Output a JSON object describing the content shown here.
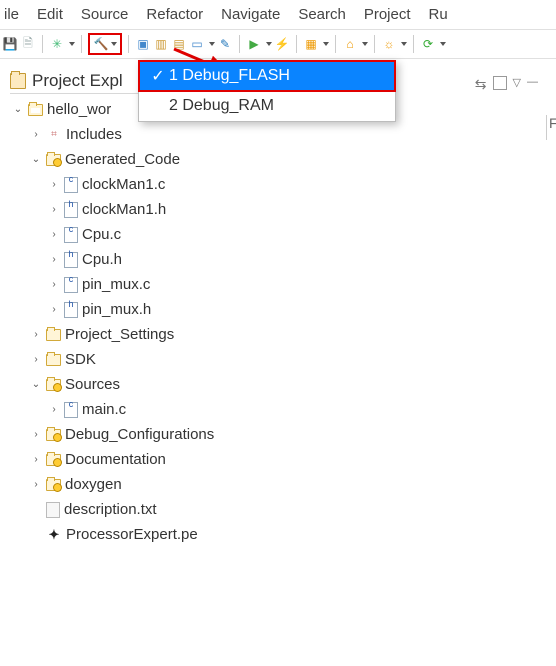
{
  "menubar": [
    "ile",
    "Edit",
    "Source",
    "Refactor",
    "Navigate",
    "Search",
    "Project",
    "Ru"
  ],
  "panel": {
    "title": "Project Expl"
  },
  "dropdown": {
    "items": [
      {
        "label": "1 Debug_FLASH",
        "checked": true
      },
      {
        "label": "2 Debug_RAM",
        "checked": false
      }
    ]
  },
  "tree": {
    "project": "hello_wor",
    "includes": "Includes",
    "generated": "Generated_Code",
    "gen_files": [
      "clockMan1.c",
      "clockMan1.h",
      "Cpu.c",
      "Cpu.h",
      "pin_mux.c",
      "pin_mux.h"
    ],
    "project_settings": "Project_Settings",
    "sdk": "SDK",
    "sources": "Sources",
    "sources_files": [
      "main.c"
    ],
    "debug_conf": "Debug_Configurations",
    "documentation": "Documentation",
    "doxygen": "doxygen",
    "description": "description.txt",
    "pe": "ProcessorExpert.pe"
  },
  "right_edge": "F"
}
